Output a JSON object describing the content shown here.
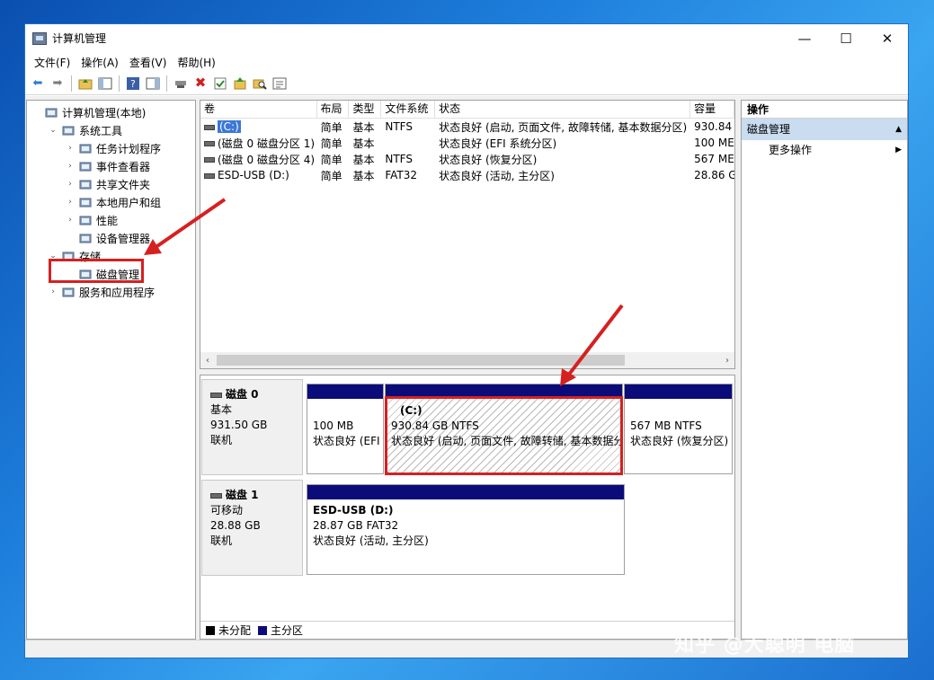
{
  "window": {
    "title": "计算机管理",
    "controls": {
      "minimize": "—",
      "maximize": "☐",
      "close": "✕"
    }
  },
  "menu": [
    "文件(F)",
    "操作(A)",
    "查看(V)",
    "帮助(H)"
  ],
  "tree": [
    {
      "label": "计算机管理(本地)",
      "level": 0,
      "expander": "",
      "icon": "computer-icon"
    },
    {
      "label": "系统工具",
      "level": 1,
      "expander": "⌄",
      "icon": "tools-icon"
    },
    {
      "label": "任务计划程序",
      "level": 2,
      "expander": "›",
      "icon": "clock-icon"
    },
    {
      "label": "事件查看器",
      "level": 2,
      "expander": "›",
      "icon": "event-viewer-icon"
    },
    {
      "label": "共享文件夹",
      "level": 2,
      "expander": "›",
      "icon": "shared-folder-icon"
    },
    {
      "label": "本地用户和组",
      "level": 2,
      "expander": "›",
      "icon": "users-icon"
    },
    {
      "label": "性能",
      "level": 2,
      "expander": "›",
      "icon": "performance-icon"
    },
    {
      "label": "设备管理器",
      "level": 2,
      "expander": "",
      "icon": "device-manager-icon"
    },
    {
      "label": "存储",
      "level": 1,
      "expander": "⌄",
      "icon": "storage-icon"
    },
    {
      "label": "磁盘管理",
      "level": 2,
      "expander": "",
      "icon": "disk-icon",
      "selected": true
    },
    {
      "label": "服务和应用程序",
      "level": 1,
      "expander": "›",
      "icon": "services-icon"
    }
  ],
  "volumes": {
    "columns": [
      "卷",
      "布局",
      "类型",
      "文件系统",
      "状态",
      "容量"
    ],
    "rows": [
      {
        "vol": "(C:)",
        "layout": "简单",
        "type": "基本",
        "fs": "NTFS",
        "status": "状态良好 (启动, 页面文件, 故障转储, 基本数据分区)",
        "cap": "930.84",
        "selected": true
      },
      {
        "vol": "(磁盘 0 磁盘分区 1)",
        "layout": "简单",
        "type": "基本",
        "fs": "",
        "status": "状态良好 (EFI 系统分区)",
        "cap": "100 ME"
      },
      {
        "vol": "(磁盘 0 磁盘分区 4)",
        "layout": "简单",
        "type": "基本",
        "fs": "NTFS",
        "status": "状态良好 (恢复分区)",
        "cap": "567 ME"
      },
      {
        "vol": "ESD-USB (D:)",
        "layout": "简单",
        "type": "基本",
        "fs": "FAT32",
        "status": "状态良好 (活动, 主分区)",
        "cap": "28.86 G"
      }
    ]
  },
  "disks": [
    {
      "name": "磁盘 0",
      "kind": "基本",
      "size": "931.50 GB",
      "state": "联机",
      "partitions": [
        {
          "title": "",
          "line1": "100 MB",
          "line2": "状态良好 (EFI"
        },
        {
          "title": "(C:)",
          "line1": "930.84 GB NTFS",
          "line2": "状态良好 (启动, 页面文件, 故障转储, 基本数据分",
          "highlighted": true
        },
        {
          "title": "",
          "line1": "567 MB NTFS",
          "line2": "状态良好 (恢复分区)"
        }
      ]
    },
    {
      "name": "磁盘 1",
      "kind": "可移动",
      "size": "28.88 GB",
      "state": "联机",
      "partitions": [
        {
          "title": "ESD-USB  (D:)",
          "line1": "28.87 GB FAT32",
          "line2": "状态良好 (活动, 主分区)"
        }
      ]
    }
  ],
  "legend": [
    {
      "label": "未分配",
      "color": "#000000"
    },
    {
      "label": "主分区",
      "color": "#0b0b7a"
    }
  ],
  "actions": {
    "header": "操作",
    "section": "磁盘管理",
    "section_arrow": "▲",
    "item": "更多操作",
    "item_arrow": "▶"
  },
  "watermark": "知乎 @大聪明 电脑",
  "colors": {
    "annotation_red": "#d62020",
    "primary_partition": "#0b0b7a",
    "selection_blue": "#3b78d8"
  }
}
